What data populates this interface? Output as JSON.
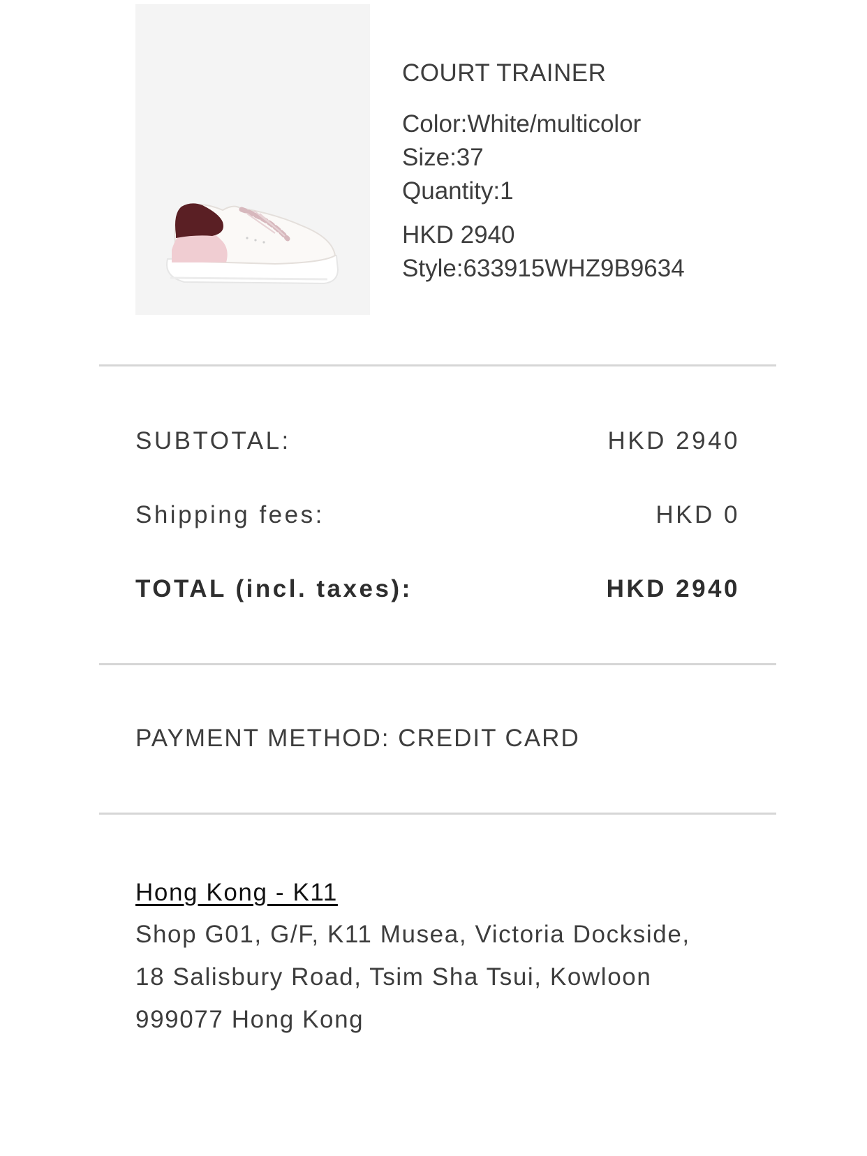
{
  "product": {
    "image_alt": "white court trainer sneaker with burgundy heel tab",
    "name": "COURT TRAINER",
    "color": "Color:White/multicolor",
    "size": "Size:37",
    "quantity": "Quantity:1",
    "price": "HKD 2940",
    "style": "Style:633915WHZ9B9634"
  },
  "summary": {
    "subtotal_label": "SUBTOTAL:",
    "subtotal_value": "HKD 2940",
    "shipping_label": "Shipping fees:",
    "shipping_value": "HKD 0",
    "total_label": "TOTAL (incl. taxes):",
    "total_value": "HKD 2940"
  },
  "payment": {
    "label": "PAYMENT METHOD: CREDIT CARD"
  },
  "store": {
    "name": "Hong Kong - K11",
    "address_lines": [
      "Shop G01, G/F, K11 Musea, Victoria Dockside,",
      "18 Salisbury Road, Tsim Sha Tsui, Kowloon",
      "999077 Hong Kong"
    ]
  },
  "colors": {
    "text": "#3d3d3d",
    "divider": "#d6d6d6",
    "image_bg": "#f4f4f4",
    "heel_tab": "#5a1f24",
    "heel_pink": "#f0cdd2",
    "link": "#111111"
  }
}
